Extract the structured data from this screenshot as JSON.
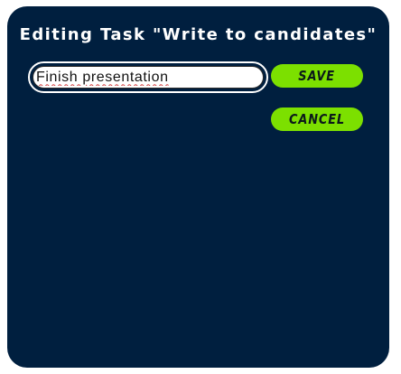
{
  "dialog": {
    "title": "Editing Task \"Write to candidates\""
  },
  "task_input": {
    "value": "Finish presentation"
  },
  "actions": {
    "save_label": "SAVE",
    "cancel_label": "CANCEL"
  },
  "colors": {
    "panel_background": "#001f3f",
    "button_background": "#7ce000",
    "button_text": "#0b1a1a",
    "title_text": "#ffffff"
  }
}
